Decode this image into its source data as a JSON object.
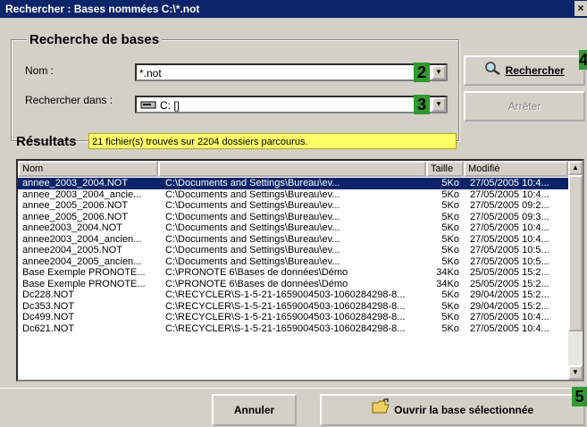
{
  "window": {
    "title": "Rechercher : Bases nommées C:\\*.not",
    "close_label": "×"
  },
  "search_group": {
    "title": "Recherche de bases",
    "name_label": "Nom :",
    "name_value": "*.not",
    "look_in_label": "Rechercher dans :",
    "look_in_value": "C: []"
  },
  "badges": {
    "b2": "2",
    "b3": "3",
    "b4": "4",
    "b5": "5"
  },
  "buttons": {
    "search": "Rechercher",
    "stop": "Arrêter",
    "cancel": "Annuler",
    "open": "Ouvrir la base sélectionnée"
  },
  "results": {
    "title": "Résultats",
    "status": "21 fichier(s) trouvés sur 2204 dossiers parcourus.",
    "columns": [
      "Nom",
      "",
      "Taille",
      "Modifié"
    ],
    "rows": [
      [
        "annee_2003_2004.NOT",
        "C:\\Documents and Settings\\Bureau\\ev...",
        "5Ko",
        "27/05/2005 10:4..."
      ],
      [
        "annee_2003_2004_ancie...",
        "C:\\Documents and Settings\\Bureau\\ev...",
        "5Ko",
        "27/05/2005 10:4..."
      ],
      [
        "annee_2005_2006.NOT",
        "C:\\Documents and Settings\\Bureau\\ev...",
        "5Ko",
        "27/05/2005 09:2..."
      ],
      [
        "annee_2005_2006.NOT",
        "C:\\Documents and Settings\\Bureau\\ev...",
        "5Ko",
        "27/05/2005 09:3..."
      ],
      [
        "annee2003_2004.NOT",
        "C:\\Documents and Settings\\Bureau\\ev...",
        "5Ko",
        "27/05/2005 10:4..."
      ],
      [
        "annee2003_2004_ancien...",
        "C:\\Documents and Settings\\Bureau\\ev...",
        "5Ko",
        "27/05/2005 10:4..."
      ],
      [
        "annee2004_2005.NOT",
        "C:\\Documents and Settings\\Bureau\\ev...",
        "5Ko",
        "27/05/2005 10:5..."
      ],
      [
        "annee2004_2005_ancien...",
        "C:\\Documents and Settings\\Bureau\\ev...",
        "5Ko",
        "27/05/2005 10:5..."
      ],
      [
        "Base Exemple PRONOTE...",
        "C:\\PRONOTE 6\\Bases de données\\Démo",
        "34Ko",
        "25/05/2005 15:2..."
      ],
      [
        "Base Exemple PRONOTE...",
        "C:\\PRONOTE 6\\Bases de données\\Démo",
        "34Ko",
        "25/05/2005 15:2..."
      ],
      [
        "Dc228.NOT",
        "C:\\RECYCLER\\S-1-5-21-1659004503-1060284298-8...",
        "5Ko",
        "29/04/2005 15:2..."
      ],
      [
        "Dc353.NOT",
        "C:\\RECYCLER\\S-1-5-21-1659004503-1060284298-8...",
        "5Ko",
        "29/04/2005 15:2..."
      ],
      [
        "Dc499.NOT",
        "C:\\RECYCLER\\S-1-5-21-1659004503-1060284298-8...",
        "5Ko",
        "27/05/2005 10:4..."
      ],
      [
        "Dc621.NOT",
        "C:\\RECYCLER\\S-1-5-21-1659004503-1060284298-8...",
        "5Ko",
        "27/05/2005 10:4..."
      ]
    ]
  },
  "colors": {
    "title_bar": "#0a246a",
    "selection": "#0a246a",
    "status_bg": "#ffff66",
    "badge": "#2f9a2f",
    "window_bg": "#d4d0c8"
  },
  "icons": {
    "search_button": "magnifier-icon",
    "open_button": "open-folder-icon",
    "drive": "drive-icon"
  }
}
